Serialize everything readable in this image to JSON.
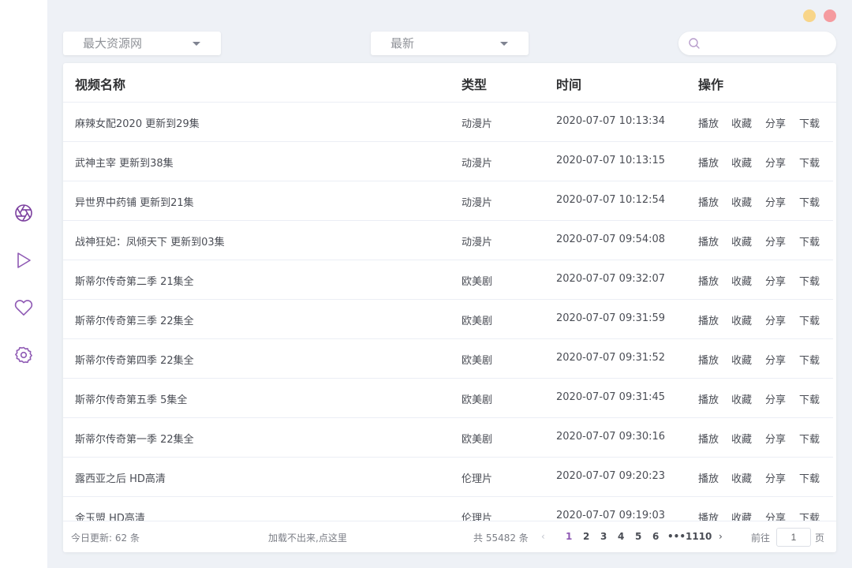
{
  "sidebar": {
    "items": [
      {
        "icon": "aperture-icon",
        "active": true
      },
      {
        "icon": "play-icon"
      },
      {
        "icon": "heart-icon"
      },
      {
        "icon": "settings-icon"
      }
    ]
  },
  "colors": {
    "accent": "#8f5ab4",
    "min": "#f8d589",
    "close": "#f59b9f"
  },
  "filters": {
    "source_value": "最大资源网",
    "sort_value": "最新",
    "search_placeholder": ""
  },
  "table": {
    "headers": {
      "name": "视频名称",
      "type": "类型",
      "time": "时间",
      "actions": "操作"
    },
    "action_labels": {
      "play": "播放",
      "collect": "收藏",
      "share": "分享",
      "download": "下载"
    },
    "rows": [
      {
        "name": "麻辣女配2020 更新到29集",
        "type": "动漫片",
        "time": "2020-07-07 10:13:34"
      },
      {
        "name": "武神主宰 更新到38集",
        "type": "动漫片",
        "time": "2020-07-07 10:13:15"
      },
      {
        "name": "异世界中药铺 更新到21集",
        "type": "动漫片",
        "time": "2020-07-07 10:12:54"
      },
      {
        "name": "战神狂妃：凤倾天下 更新到03集",
        "type": "动漫片",
        "time": "2020-07-07 09:54:08"
      },
      {
        "name": "斯蒂尔传奇第二季 21集全",
        "type": "欧美剧",
        "time": "2020-07-07 09:32:07"
      },
      {
        "name": "斯蒂尔传奇第三季 22集全",
        "type": "欧美剧",
        "time": "2020-07-07 09:31:59"
      },
      {
        "name": "斯蒂尔传奇第四季 22集全",
        "type": "欧美剧",
        "time": "2020-07-07 09:31:52"
      },
      {
        "name": "斯蒂尔传奇第五季 5集全",
        "type": "欧美剧",
        "time": "2020-07-07 09:31:45"
      },
      {
        "name": "斯蒂尔传奇第一季 22集全",
        "type": "欧美剧",
        "time": "2020-07-07 09:30:16"
      },
      {
        "name": "露西亚之后 HD高清",
        "type": "伦理片",
        "time": "2020-07-07 09:20:23"
      },
      {
        "name": "金玉盟 HD高清",
        "type": "伦理片",
        "time": "2020-07-07 09:19:03"
      }
    ]
  },
  "footer": {
    "today": "今日更新: 62 条",
    "reload": "加载不出来,点这里",
    "total": "共 55482 条",
    "pages": [
      "1",
      "2",
      "3",
      "4",
      "5",
      "6"
    ],
    "more": "•••",
    "last_page": "1110",
    "current_page": "1",
    "goto_prefix": "前往",
    "goto_value": "1",
    "goto_suffix": "页"
  }
}
